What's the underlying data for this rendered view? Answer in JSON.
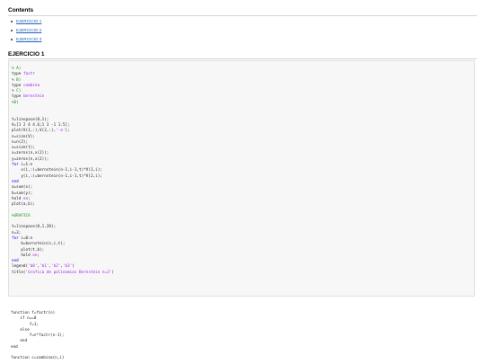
{
  "contents_heading": "Contents",
  "toc": [
    {
      "label": "EJERCICIO 1"
    },
    {
      "label": "EJERCICIO 2"
    },
    {
      "label": "EJERCICIO 3"
    }
  ],
  "section_heading": "EJERCICIO 1",
  "code_block": [
    [
      {
        "t": "% A)",
        "k": "c"
      }
    ],
    [
      {
        "t": "type ",
        "k": ""
      },
      {
        "t": "factr",
        "k": "s"
      }
    ],
    [
      {
        "t": "% B)",
        "k": "c"
      }
    ],
    [
      {
        "t": "type ",
        "k": ""
      },
      {
        "t": "combina",
        "k": "s"
      }
    ],
    [
      {
        "t": "% C)",
        "k": "c"
      }
    ],
    [
      {
        "t": "type ",
        "k": ""
      },
      {
        "t": "bernstein",
        "k": "s"
      }
    ],
    [
      {
        "t": "%D)",
        "k": "c"
      }
    ],
    [],
    [],
    [
      {
        "t": "t=linspace(0,1);",
        "k": ""
      }
    ],
    [
      {
        "t": "V=[1 2 4 4.6;1 3 -1 1.5];",
        "k": ""
      }
    ],
    [
      {
        "t": "plot(V(1,:),V(2,:),",
        "k": ""
      },
      {
        "t": "'-o'",
        "k": "s"
      },
      {
        "t": ");",
        "k": ""
      }
    ],
    [
      {
        "t": "n=size(V);",
        "k": ""
      }
    ],
    [
      {
        "t": "n=n(2);",
        "k": ""
      }
    ],
    [
      {
        "t": "x=size(t);",
        "k": ""
      }
    ],
    [
      {
        "t": "x=zeros(n,x(2));",
        "k": ""
      }
    ],
    [
      {
        "t": "y=zeros(n,x(2));",
        "k": ""
      }
    ],
    [
      {
        "t": "for",
        "k": "kw"
      },
      {
        "t": " i=1:n",
        "k": ""
      }
    ],
    [
      {
        "t": "    x(i,:)=bernstein(n-1,i-1,t)*V(1,i);",
        "k": ""
      }
    ],
    [
      {
        "t": "    y(i,:)=bernstein(n-1,i-1,t)*V(2,i);",
        "k": ""
      }
    ],
    [
      {
        "t": "end",
        "k": "kw"
      }
    ],
    [
      {
        "t": "a=sum(x);",
        "k": ""
      }
    ],
    [
      {
        "t": "b=sum(y);",
        "k": ""
      }
    ],
    [
      {
        "t": "hold ",
        "k": ""
      },
      {
        "t": "on",
        "k": "s"
      },
      {
        "t": ";",
        "k": ""
      }
    ],
    [
      {
        "t": "plot(a,b);",
        "k": ""
      }
    ],
    [],
    [
      {
        "t": "%GRAFICA",
        "k": "c"
      }
    ],
    [],
    [
      {
        "t": "t=linspace(0,1,20);",
        "k": ""
      }
    ],
    [
      {
        "t": "n=3;",
        "k": ""
      }
    ],
    [
      {
        "t": "for",
        "k": "kw"
      },
      {
        "t": " i=0:n",
        "k": ""
      }
    ],
    [
      {
        "t": "    b=bernstein(n,i,t);",
        "k": ""
      }
    ],
    [
      {
        "t": "    plot(t,b);",
        "k": ""
      }
    ],
    [
      {
        "t": "    hold ",
        "k": ""
      },
      {
        "t": "on",
        "k": "s"
      },
      {
        "t": ";",
        "k": ""
      }
    ],
    [
      {
        "t": "end",
        "k": "kw"
      }
    ],
    [
      {
        "t": "legend(",
        "k": ""
      },
      {
        "t": "'b0'",
        "k": "s"
      },
      {
        "t": ",",
        "k": ""
      },
      {
        "t": "'b1'",
        "k": "s"
      },
      {
        "t": ",",
        "k": ""
      },
      {
        "t": "'b2'",
        "k": "s"
      },
      {
        "t": ",",
        "k": ""
      },
      {
        "t": "'b3'",
        "k": "s"
      },
      {
        "t": ")",
        "k": ""
      }
    ],
    [
      {
        "t": "title(",
        "k": ""
      },
      {
        "t": "'Grafica de polinomios Bernstein n=3'",
        "k": "s"
      },
      {
        "t": ")",
        "k": ""
      }
    ]
  ],
  "output_block": [
    [
      {
        "t": "function f=factr(n)",
        "k": ""
      }
    ],
    [
      {
        "t": "    if n==0",
        "k": ""
      }
    ],
    [
      {
        "t": "        f=1;",
        "k": ""
      }
    ],
    [
      {
        "t": "    else",
        "k": ""
      }
    ],
    [
      {
        "t": "        f=n*factr(n-1);",
        "k": ""
      }
    ],
    [
      {
        "t": "    end",
        "k": ""
      }
    ],
    [
      {
        "t": "end",
        "k": ""
      }
    ],
    [],
    [
      {
        "t": "function c=combina(n,i)",
        "k": ""
      }
    ]
  ]
}
